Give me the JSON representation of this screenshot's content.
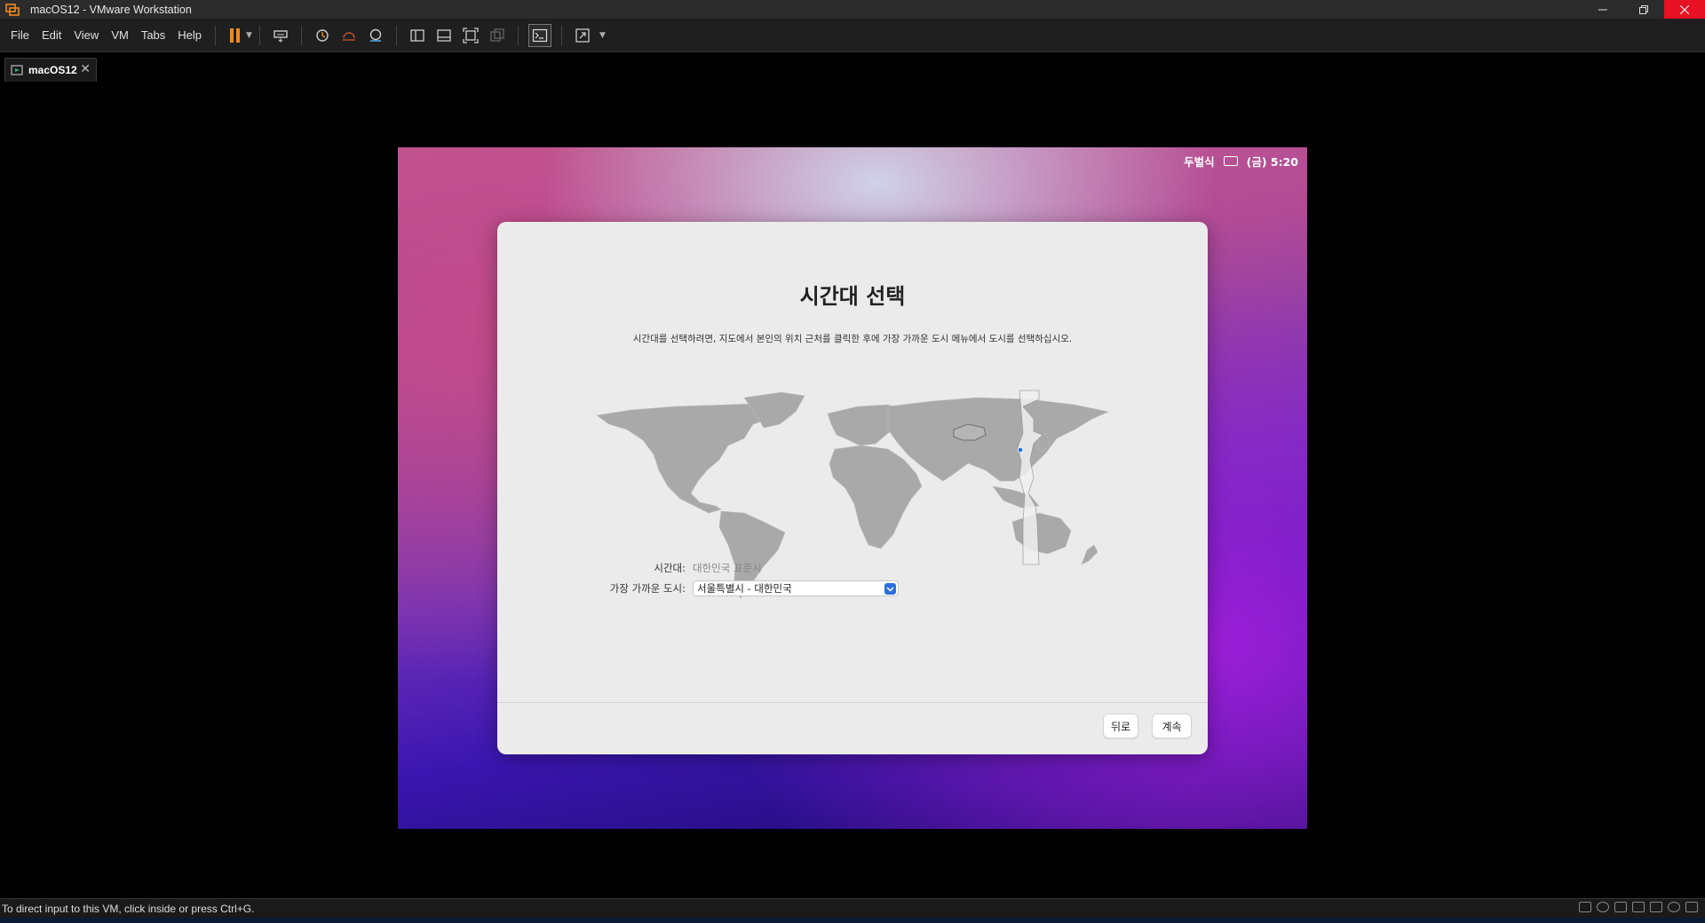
{
  "window": {
    "title": "macOS12 - VMware Workstation",
    "controls": [
      "minimize",
      "restore",
      "close"
    ]
  },
  "menu": [
    "File",
    "Edit",
    "View",
    "VM",
    "Tabs",
    "Help"
  ],
  "toolbar_icons": [
    "pause-icon",
    "send-ctrl-alt-del-icon",
    "snapshot-icon",
    "revert-snapshot-icon",
    "snapshot-manager-icon",
    "library-icon",
    "thumbnail-bar-icon",
    "fullscreen-icon",
    "unity-icon",
    "console-view-icon",
    "stretch-icon"
  ],
  "tab": {
    "label": "macOS12"
  },
  "vm": {
    "menubar": {
      "input_source": "두벌식",
      "clock": "(금) 5:20"
    },
    "dialog": {
      "title": "시간대 선택",
      "description": "시간대를 선택하려면, 지도에서 본인의 위치 근처를 클릭한 후에 가장 가까운 도시 메뉴에서 도시를 선택하십시오.",
      "timezone_label": "시간대:",
      "timezone_value": "대한민국 표준시",
      "city_label": "가장 가까운 도시:",
      "city_value": "서울특별시 - 대한민국",
      "back_button": "뒤로",
      "continue_button": "계속"
    }
  },
  "status": {
    "text": "To direct input to this VM, click inside or press Ctrl+G."
  },
  "colors": {
    "accent": "#2a6fe0",
    "close_red": "#e81123",
    "pause_orange": "#f08a1c"
  }
}
